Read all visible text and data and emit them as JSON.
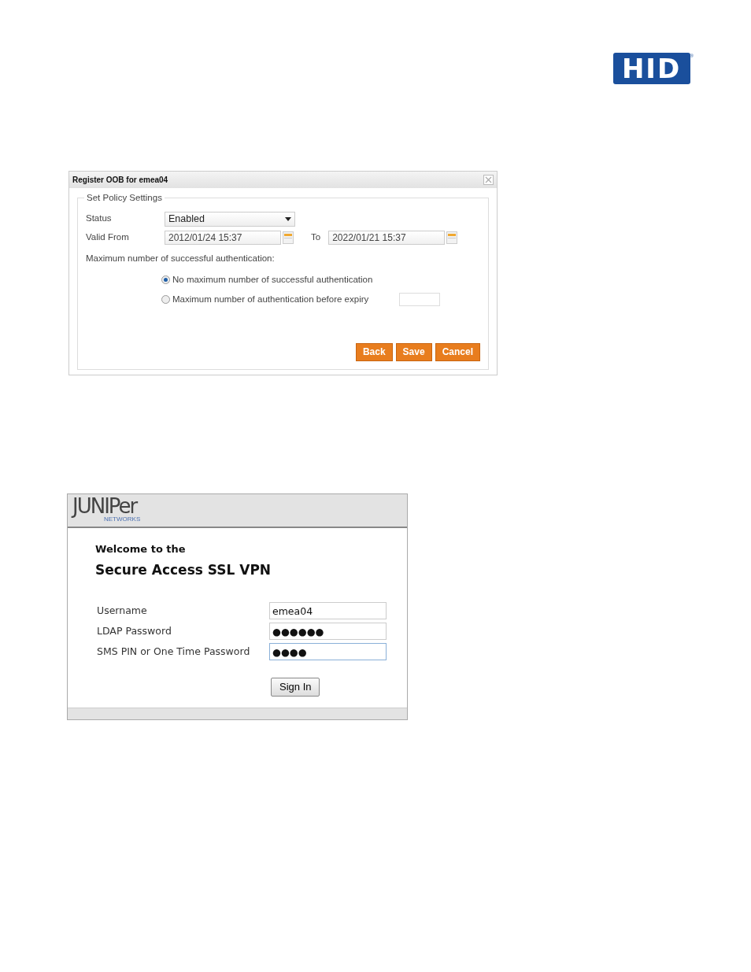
{
  "logo": {
    "text": "HID",
    "mark": "®"
  },
  "dialog": {
    "title": "Register OOB for emea04",
    "fieldset": "Set Policy Settings",
    "status": {
      "label": "Status",
      "value": "Enabled"
    },
    "valid_from": {
      "label": "Valid From",
      "value": "2012/01/24 15:37"
    },
    "valid_to": {
      "label": "To",
      "value": "2022/01/21 15:37"
    },
    "max_label": "Maximum number of successful authentication:",
    "options": [
      {
        "label": "No maximum number of successful authentication",
        "selected": true
      },
      {
        "label": "Maximum number of authentication before expiry",
        "selected": false
      }
    ],
    "buttons": [
      "Back",
      "Save",
      "Cancel"
    ]
  },
  "login": {
    "brand": "JUNIPer",
    "brand_sub": "NETWORKS",
    "welcome": "Welcome to the",
    "heading": "Secure Access SSL VPN",
    "fields": [
      {
        "label": "Username",
        "value": "emea04",
        "focused": false
      },
      {
        "label": "LDAP Password",
        "value": "●●●●●●",
        "focused": false
      },
      {
        "label": "SMS PIN or One Time Password",
        "value": "●●●●",
        "focused": true
      }
    ],
    "button": "Sign In"
  }
}
